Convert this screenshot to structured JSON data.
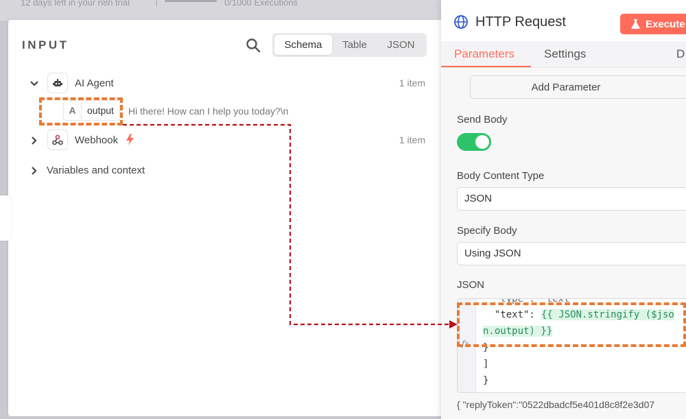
{
  "topbar": {
    "trial_text": "12 days left in your n8n trial",
    "executions_text": "0/1000 Executions"
  },
  "input_panel": {
    "heading": "INPUT",
    "view_tabs": [
      {
        "label": "Schema",
        "active": true
      },
      {
        "label": "Table",
        "active": false
      },
      {
        "label": "JSON",
        "active": false
      }
    ],
    "tree": {
      "ai_agent": {
        "label": "AI Agent",
        "count": "1 item",
        "icon": "robot-icon",
        "expanded": true
      },
      "output_field": {
        "type_glyph": "A",
        "name": "output",
        "value": "Hi there! How can I help you today?\\n"
      },
      "webhook": {
        "label": "Webhook",
        "count": "1 item",
        "icon": "webhook-icon",
        "trigger_icon": "lightning-icon"
      },
      "variables": {
        "label": "Variables and context"
      }
    }
  },
  "right_panel": {
    "title": "HTTP Request",
    "execute_label": "Execute",
    "tabs": [
      {
        "label": "Parameters",
        "active": true
      },
      {
        "label": "Settings",
        "active": false
      },
      {
        "label": "D",
        "active": false
      }
    ],
    "add_parameter_label": "Add Parameter",
    "send_body_label": "Send Body",
    "send_body_on": true,
    "body_content_type_label": "Body Content Type",
    "body_content_type_value": "JSON",
    "specify_body_label": "Specify Body",
    "specify_body_value": "Using JSON",
    "json_label": "JSON",
    "code": {
      "line0": "  \"type\": \"text\"",
      "line1_key": "  \"text\": ",
      "line1_expr": "{{ JSON.stringify ($jso",
      "line2_expr": "n.output) }}",
      "line3": "}",
      "line4": "]",
      "line5": "}"
    },
    "result_preview": "{ \"replyToken\":\"0522dbadcf5e401d8c8f2e3d07"
  },
  "colors": {
    "accent": "#ff6d5a",
    "toggle_on": "#2cc36b",
    "highlight": "#e97a33",
    "arrow": "#b5121b"
  }
}
